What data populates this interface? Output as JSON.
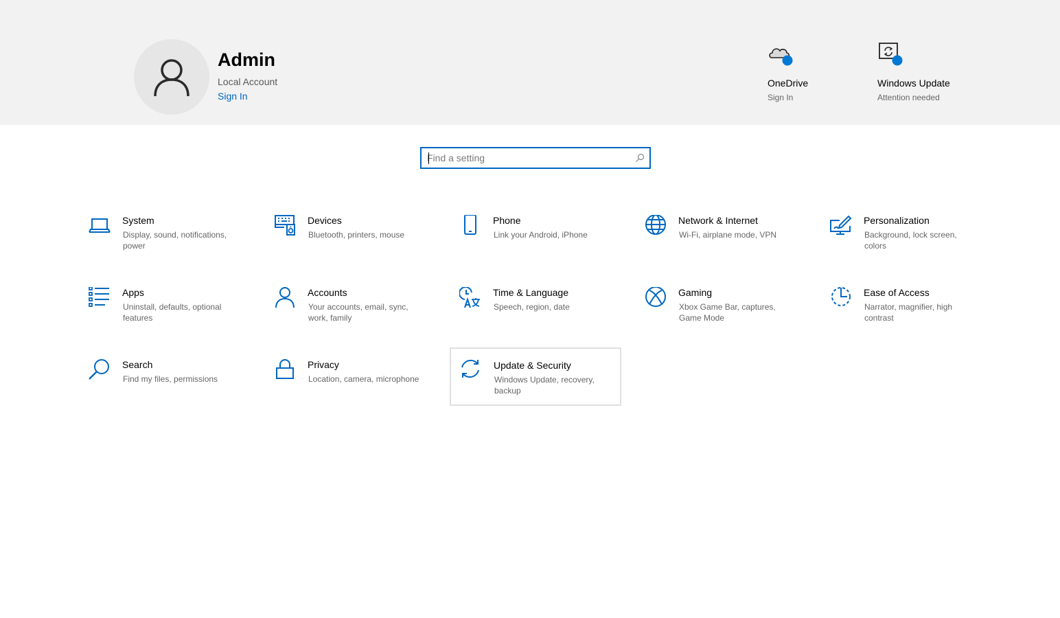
{
  "account": {
    "name": "Admin",
    "type": "Local Account",
    "sign_in": "Sign In"
  },
  "quick_links": [
    {
      "title": "OneDrive",
      "subtitle": "Sign In",
      "icon": "onedrive-cloud-icon"
    },
    {
      "title": "Windows Update",
      "subtitle": "Attention needed",
      "icon": "windows-update-icon"
    }
  ],
  "search": {
    "placeholder": "Find a setting"
  },
  "categories": [
    {
      "title": "System",
      "desc": "Display, sound, notifications, power",
      "icon": "laptop-icon"
    },
    {
      "title": "Devices",
      "desc": "Bluetooth, printers, mouse",
      "icon": "keyboard-speaker-icon"
    },
    {
      "title": "Phone",
      "desc": "Link your Android, iPhone",
      "icon": "phone-icon"
    },
    {
      "title": "Network & Internet",
      "desc": "Wi-Fi, airplane mode, VPN",
      "icon": "globe-icon"
    },
    {
      "title": "Personalization",
      "desc": "Background, lock screen, colors",
      "icon": "paintbrush-icon"
    },
    {
      "title": "Apps",
      "desc": "Uninstall, defaults, optional features",
      "icon": "apps-list-icon"
    },
    {
      "title": "Accounts",
      "desc": "Your accounts, email, sync, work, family",
      "icon": "person-icon"
    },
    {
      "title": "Time & Language",
      "desc": "Speech, region, date",
      "icon": "clock-language-icon"
    },
    {
      "title": "Gaming",
      "desc": "Xbox Game Bar, captures, Game Mode",
      "icon": "xbox-icon"
    },
    {
      "title": "Ease of Access",
      "desc": "Narrator, magnifier, high contrast",
      "icon": "ease-of-access-icon"
    },
    {
      "title": "Search",
      "desc": "Find my files, permissions",
      "icon": "magnifier-icon"
    },
    {
      "title": "Privacy",
      "desc": "Location, camera, microphone",
      "icon": "padlock-icon"
    },
    {
      "title": "Update & Security",
      "desc": "Windows Update, recovery, backup",
      "icon": "sync-arrows-icon"
    }
  ],
  "colors": {
    "accent": "#0067c0",
    "header_bg": "#f2f2f2",
    "badge": "#0078d4"
  }
}
